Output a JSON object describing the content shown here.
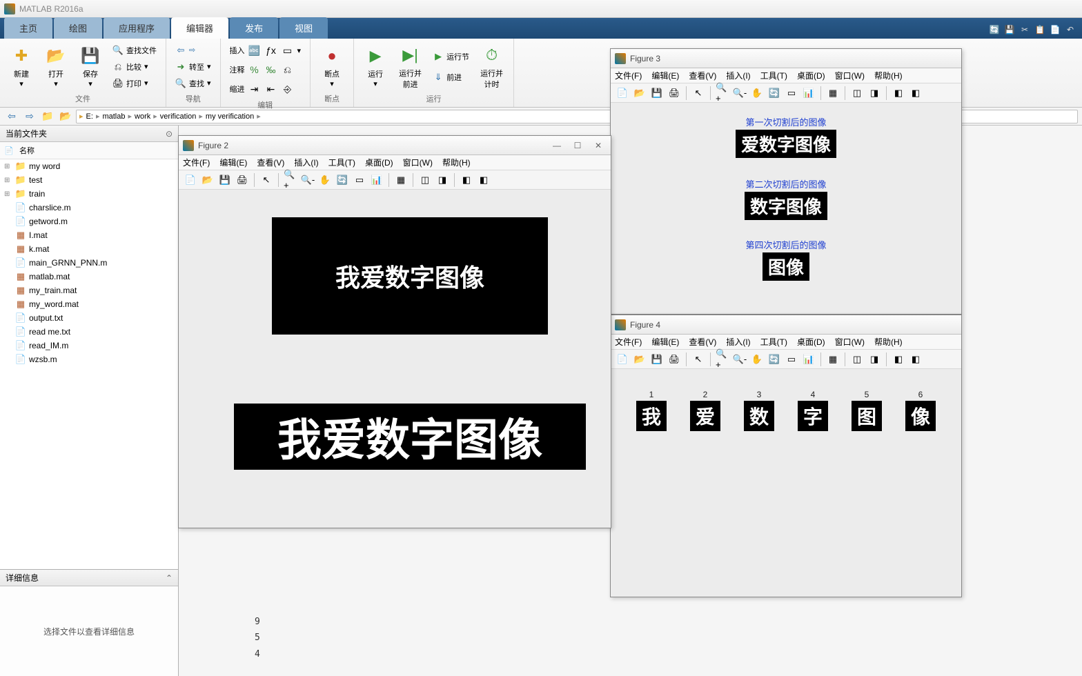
{
  "app_title": "MATLAB R2016a",
  "tabs": [
    "主页",
    "绘图",
    "应用程序",
    "编辑器",
    "发布",
    "视图"
  ],
  "active_tab_index": 3,
  "toolstrip": {
    "file": {
      "label": "文件",
      "new": "新建",
      "open": "打开",
      "save": "保存",
      "find_files": "查找文件",
      "compare": "比较",
      "print": "打印"
    },
    "nav": {
      "label": "导航",
      "goto": "转至",
      "find": "查找"
    },
    "edit": {
      "label": "编辑",
      "insert": "插入",
      "comment": "注释",
      "indent": "缩进"
    },
    "break": {
      "label": "断点",
      "breakpoints": "断点"
    },
    "run": {
      "label": "运行",
      "run_btn": "运行",
      "run_advance": "运行并",
      "run_advance2": "前进",
      "run_section": "运行节",
      "advance": "前进",
      "run_timer": "运行并",
      "run_timer2": "计时"
    }
  },
  "addr": {
    "drive": "E:",
    "segs": [
      "matlab",
      "work",
      "verification",
      "my verification"
    ]
  },
  "left": {
    "current_folder": "当前文件夹",
    "name_col": "名称",
    "files": [
      {
        "type": "folder",
        "name": "my word"
      },
      {
        "type": "folder",
        "name": "test"
      },
      {
        "type": "folder",
        "name": "train"
      },
      {
        "type": "m",
        "name": "charslice.m"
      },
      {
        "type": "m",
        "name": "getword.m"
      },
      {
        "type": "mat",
        "name": "I.mat"
      },
      {
        "type": "mat",
        "name": "k.mat"
      },
      {
        "type": "m",
        "name": "main_GRNN_PNN.m"
      },
      {
        "type": "mat",
        "name": "matlab.mat"
      },
      {
        "type": "mat",
        "name": "my_train.mat"
      },
      {
        "type": "mat",
        "name": "my_word.mat"
      },
      {
        "type": "txt",
        "name": "output.txt"
      },
      {
        "type": "txt",
        "name": "read me.txt"
      },
      {
        "type": "m",
        "name": "read_IM.m"
      },
      {
        "type": "m",
        "name": "wzsb.m"
      }
    ],
    "detail": "详细信息",
    "detail_msg": "选择文件以查看详细信息"
  },
  "cmd_lines": [
    "9",
    "5",
    "4"
  ],
  "fig_menu": [
    "文件(F)",
    "编辑(E)",
    "查看(V)",
    "插入(I)",
    "工具(T)",
    "桌面(D)",
    "窗口(W)",
    "帮助(H)"
  ],
  "fig2": {
    "title": "Figure 2",
    "text1": "我爱数字图像",
    "text2": "我爱数字图像"
  },
  "fig3": {
    "title": "Figure 3",
    "t1": "第一次切割后的图像",
    "img1": "爱数字图像",
    "t2": "第二次切割后的图像",
    "img2": "数字图像",
    "t3": "第四次切割后的图像",
    "img3": "图像"
  },
  "fig4": {
    "title": "Figure 4",
    "chars": [
      {
        "n": "1",
        "c": "我"
      },
      {
        "n": "2",
        "c": "爱"
      },
      {
        "n": "3",
        "c": "数"
      },
      {
        "n": "4",
        "c": "字"
      },
      {
        "n": "5",
        "c": "图"
      },
      {
        "n": "6",
        "c": "像"
      }
    ]
  }
}
